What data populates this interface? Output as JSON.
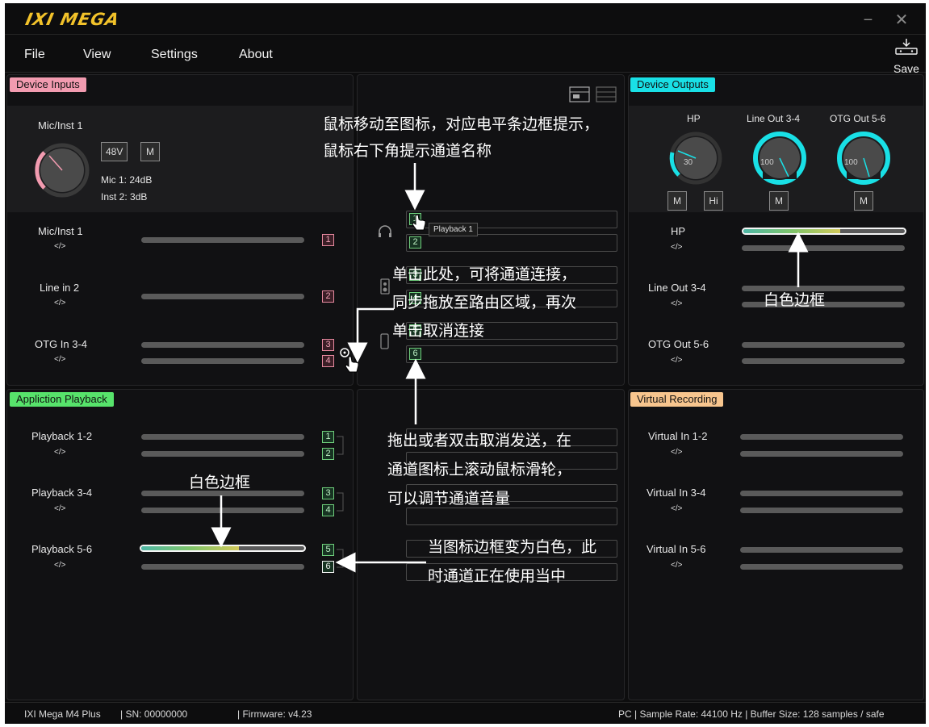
{
  "app": {
    "logo": "IXI MEGA",
    "minimize": "−",
    "close": "✕"
  },
  "menu": [
    "File",
    "View",
    "Settings",
    "About"
  ],
  "save": {
    "label": "Save"
  },
  "device_inputs": {
    "title": "Device Inputs",
    "knob_label": "Mic/Inst 1",
    "btn_48v": "48V",
    "btn_m": "M",
    "mic_readout": "Mic 1: 24dB",
    "inst_readout": "Inst 2: 3dB",
    "rows": [
      {
        "name": "Mic/Inst 1",
        "code": "</>",
        "nums": [
          "1"
        ]
      },
      {
        "name": "Line in 2",
        "code": "</>",
        "nums": [
          "2"
        ]
      },
      {
        "name": "OTG In 3-4",
        "code": "</>",
        "nums": [
          "3",
          "4"
        ]
      }
    ]
  },
  "routing": {
    "rows": [
      "1",
      "2",
      "3",
      "4",
      "5",
      "6"
    ],
    "tooltip": "Playback 1"
  },
  "device_outputs": {
    "title": "Device Outputs",
    "knobs": [
      {
        "label": "HP",
        "value": "30",
        "level": 0.3
      },
      {
        "label": "Line Out 3-4",
        "value": "100",
        "level": 1
      },
      {
        "label": "OTG Out 5-6",
        "value": "100",
        "level": 1
      }
    ],
    "btn_m": "M",
    "btn_hi": "Hi",
    "rows": [
      {
        "name": "HP",
        "code": "</>",
        "level": 0.6
      },
      {
        "name": "Line Out 3-4",
        "code": "</>"
      },
      {
        "name": "OTG Out 5-6",
        "code": "</>"
      }
    ]
  },
  "playback": {
    "title": "Appliction Playback",
    "rows": [
      {
        "name": "Playback 1-2",
        "code": "</>",
        "nums": [
          "1",
          "2"
        ]
      },
      {
        "name": "Playback 3-4",
        "code": "</>",
        "nums": [
          "3",
          "4"
        ]
      },
      {
        "name": "Playback 5-6",
        "code": "</>",
        "nums": [
          "5",
          "6"
        ],
        "level": 0.6
      }
    ]
  },
  "virtual": {
    "title": "Virtual Recording",
    "rows": [
      {
        "name": "Virtual In 1-2",
        "code": "</>"
      },
      {
        "name": "Virtual In 3-4",
        "code": "</>"
      },
      {
        "name": "Virtual In 5-6",
        "code": "</>"
      }
    ]
  },
  "annotations": {
    "a1_l1": "鼠标移动至图标，对应电平条边框提示，",
    "a1_l2": "鼠标右下角提示通道名称",
    "a2_l1": "单击此处，可将通道连接，",
    "a2_l2": "同步拖放至路由区域，再次",
    "a2_l3": "单击取消连接",
    "a3_l1": "拖出或者双击取消发送，在",
    "a3_l2": "通道图标上滚动鼠标滑轮，",
    "a3_l3": "可以调节通道音量",
    "a4_l1": "当图标边框变为白色，此",
    "a4_l2": "时通道正在使用当中",
    "white_border_1": "白色边框",
    "white_border_2": "白色边框"
  },
  "status": {
    "device": "IXI Mega M4 Plus",
    "sn": "| SN: 00000000",
    "firmware": "| Firmware: v4.23",
    "right": "PC  |  Sample Rate: 44100 Hz |   Buffer Size: 128 samples / safe"
  },
  "colors": {
    "pink": "#f29bb0",
    "cyan": "#19e0e6",
    "green": "#57e36b",
    "orange": "#f7c58e"
  }
}
